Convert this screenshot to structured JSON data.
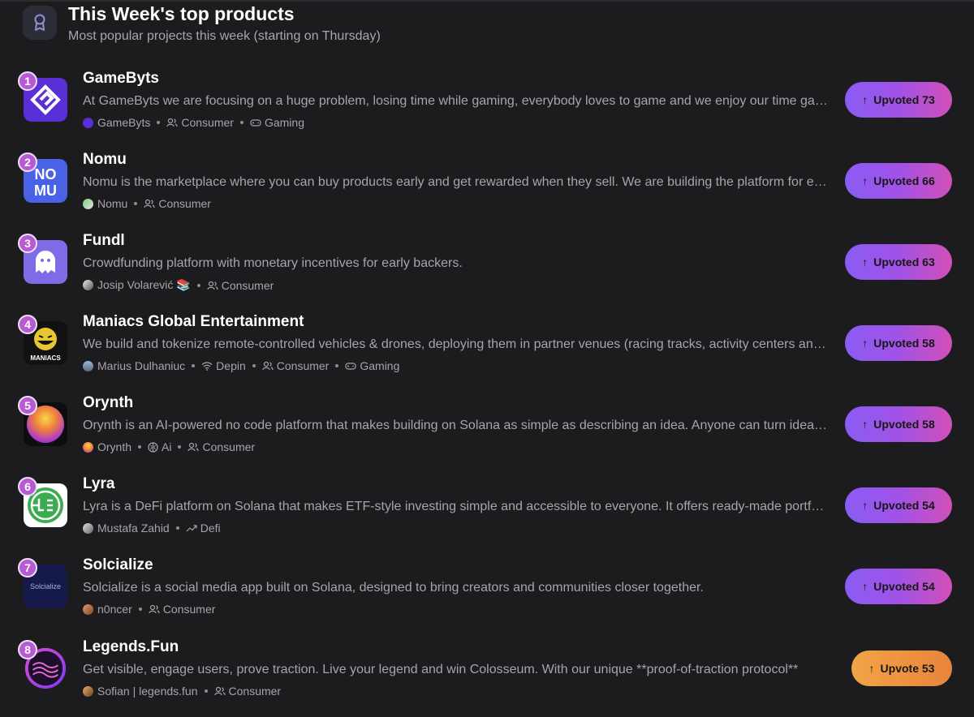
{
  "header": {
    "title": "This Week's top products",
    "subtitle": "Most popular projects this week (starting on Thursday)",
    "icon": "ribbon-award-icon"
  },
  "accent_colors": {
    "rank_badge": "#b85ad4",
    "upvoted_gradient": [
      "#8a5cf4",
      "#d150b8"
    ],
    "upvote_gradient": [
      "#f2a446",
      "#e8843a"
    ]
  },
  "products": [
    {
      "rank": "1",
      "name": "GameByts",
      "description": "At GameByts we are focusing on a huge problem, losing time while gaming, everybody loves to game and we enjoy our time gaming, but the problem",
      "tags": [
        "GameByts",
        "Consumer",
        "Gaming"
      ],
      "button": "Upvoted 73"
    },
    {
      "rank": "2",
      "name": "Nomu",
      "description": "Nomu is the marketplace where you can buy products early and get rewarded when they sell. We are building the platform for early adopters",
      "tags": [
        "Nomu",
        "Consumer"
      ],
      "button": "Upvoted 66"
    },
    {
      "rank": "3",
      "name": "Fundl",
      "description": "Crowdfunding platform with monetary incentives for early backers.",
      "tags": [
        "Josip Volarević 📚",
        "Consumer"
      ],
      "button": "Upvoted 63"
    },
    {
      "rank": "4",
      "name": "Maniacs Global Entertainment",
      "description": "We build and tokenize remote-controlled vehicles & drones, deploying them in partner venues (racing tracks, activity centers and more)",
      "tags": [
        "Marius Dulhaniuc",
        "Depin",
        "Consumer",
        "Gaming"
      ],
      "button": "Upvoted 58",
      "logo_text": "MANIACS"
    },
    {
      "rank": "5",
      "name": "Orynth",
      "description": "Orynth is an AI-powered no code platform that makes building on Solana as simple as describing an idea. Anyone can turn ideas into apps",
      "tags": [
        "Orynth",
        "Ai",
        "Consumer"
      ],
      "button": "Upvoted 58"
    },
    {
      "rank": "6",
      "name": "Lyra",
      "description": "Lyra is a DeFi platform on Solana that makes ETF-style investing simple and accessible to everyone. It offers ready-made portfolios",
      "tags": [
        "Mustafa Zahid",
        "Defi"
      ],
      "button": "Upvoted 54"
    },
    {
      "rank": "7",
      "name": "Solcialize",
      "description": "Solcialize is a social media app built on Solana, designed to bring creators and communities closer together.",
      "tags": [
        "n0ncer",
        "Consumer"
      ],
      "button": "Upvoted 54",
      "logo_text": "Solcialize"
    },
    {
      "rank": "8",
      "name": "Legends.Fun",
      "description": "Get visible, engage users, prove traction. Live your legend and win Colosseum. With our unique **proof-of-traction protocol**",
      "tags": [
        "Sofian | legends.fun",
        "Consumer"
      ],
      "button": "Upvote 53"
    }
  ]
}
